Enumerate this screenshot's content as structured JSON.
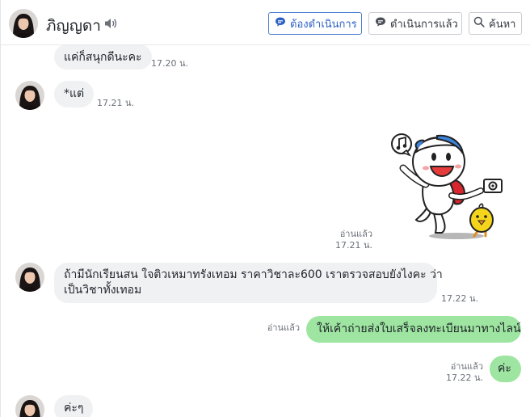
{
  "header": {
    "contact_name": "ภิญญดา",
    "buttons": {
      "todo": "ต้องดำเนินการ",
      "done": "ดำเนินการแล้ว",
      "search": "ค้นหา"
    }
  },
  "messages": [
    {
      "direction": "in",
      "text": "แค่ก็สนุกดีนะคะ",
      "time": "17.20 น."
    },
    {
      "direction": "in",
      "text": "*แต่",
      "time": "17.21 น."
    },
    {
      "direction": "out",
      "type": "sticker",
      "read": "อ่านแล้ว",
      "time": "17.21 น."
    },
    {
      "direction": "in",
      "line1": "ถ้ามีนักเรียนสน ใจติวเหมาทรังเทอม ราคาวิชาละ600 เราตรวจสอบยังไงคะ ว่า",
      "line2": "เป็นวิชาทั้งเทอม",
      "time": "17.22 น."
    },
    {
      "direction": "out",
      "text": "ให้เค้าถ่ายส่งใบเสร็จลงทะเบียนมาทางไลน์",
      "read": "อ่านแล้ว"
    },
    {
      "direction": "out",
      "text": "ค่ะ",
      "read": "อ่านแล้ว",
      "time": "17.22 น."
    },
    {
      "direction": "in",
      "text": "ค่ะๆ"
    }
  ],
  "colors": {
    "incoming_bubble": "#eff1f3",
    "outgoing_bubble": "#9de5a0",
    "primary_button": "#2f62c4"
  }
}
